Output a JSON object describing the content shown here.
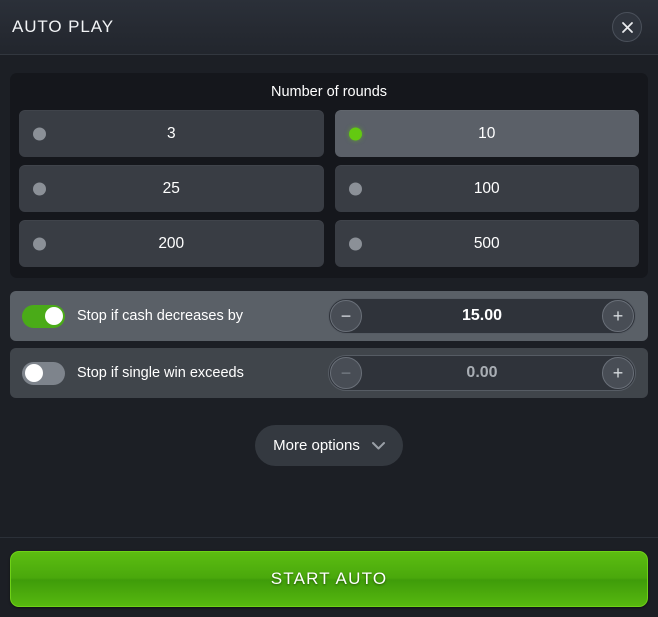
{
  "header": {
    "title": "AUTO PLAY",
    "close_icon": "close-icon"
  },
  "rounds": {
    "title": "Number of rounds",
    "options": [
      {
        "label": "3",
        "selected": false
      },
      {
        "label": "10",
        "selected": true
      },
      {
        "label": "25",
        "selected": false
      },
      {
        "label": "100",
        "selected": false
      },
      {
        "label": "200",
        "selected": false
      },
      {
        "label": "500",
        "selected": false
      }
    ]
  },
  "stop_conditions": [
    {
      "label": "Stop if cash decreases by",
      "enabled": true,
      "value": "15.00",
      "minus_label": "−",
      "plus_label": "+"
    },
    {
      "label": "Stop if single win exceeds",
      "enabled": false,
      "value": "0.00",
      "minus_label": "−",
      "plus_label": "+"
    }
  ],
  "more_options": {
    "label": "More options",
    "chevron_icon": "chevron-down-icon"
  },
  "start": {
    "label": "START AUTO"
  },
  "colors": {
    "accent_green": "#63c911",
    "toggle_on": "#4aab18",
    "panel_bg": "#15171c",
    "dialog_bg": "#1c1f25",
    "option_bg": "#393d44",
    "option_selected_bg": "#5b6068"
  }
}
